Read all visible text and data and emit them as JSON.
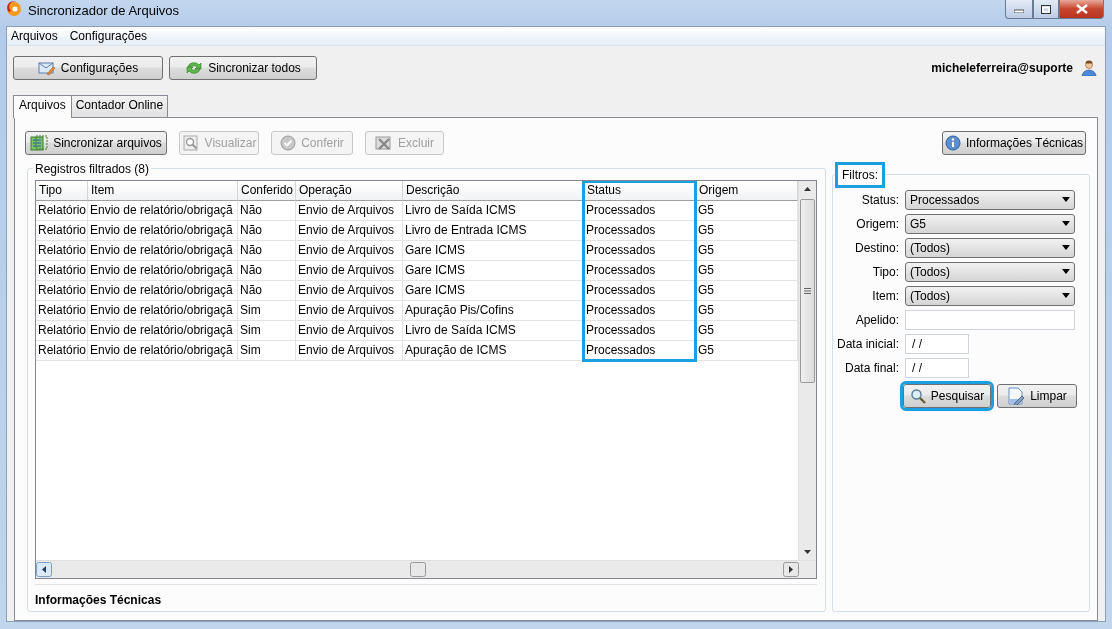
{
  "window": {
    "title": "Sincronizador de Arquivos"
  },
  "menu": [
    {
      "label": "Arquivos"
    },
    {
      "label": "Configurações"
    }
  ],
  "toolbar": [
    {
      "label": "Configurações"
    },
    {
      "label": "Sincronizar todos"
    }
  ],
  "user": "micheleferreira@suporte",
  "tabs": [
    {
      "label": "Arquivos",
      "selected": true
    },
    {
      "label": "Contador Online",
      "selected": false
    }
  ],
  "actions": [
    {
      "label": "Sincronizar arquivos",
      "disabled": false
    },
    {
      "label": "Visualizar",
      "disabled": true
    },
    {
      "label": "Conferir",
      "disabled": true
    },
    {
      "label": "Excluir",
      "disabled": true
    }
  ],
  "info_button": {
    "label": "Informações Técnicas"
  },
  "records": {
    "title": "Registros filtrados (8)",
    "columns": [
      {
        "label": "Tipo",
        "highlighted": false
      },
      {
        "label": "Item",
        "highlighted": false
      },
      {
        "label": "Conferido",
        "highlighted": false
      },
      {
        "label": "Operação",
        "highlighted": false
      },
      {
        "label": "Descrição",
        "highlighted": false
      },
      {
        "label": "Status",
        "highlighted": true
      },
      {
        "label": "Origem",
        "highlighted": false
      }
    ],
    "rows": [
      [
        "Relatório",
        "Envio de relatório/obrigaçã",
        "Não",
        "Envio de Arquivos",
        "Livro de Saída ICMS",
        "Processados",
        "G5"
      ],
      [
        "Relatório",
        "Envio de relatório/obrigaçã",
        "Não",
        "Envio de Arquivos",
        "Livro de Entrada ICMS",
        "Processados",
        "G5"
      ],
      [
        "Relatório",
        "Envio de relatório/obrigaçã",
        "Não",
        "Envio de Arquivos",
        "Gare ICMS",
        "Processados",
        "G5"
      ],
      [
        "Relatório",
        "Envio de relatório/obrigaçã",
        "Não",
        "Envio de Arquivos",
        "Gare ICMS",
        "Processados",
        "G5"
      ],
      [
        "Relatório",
        "Envio de relatório/obrigaçã",
        "Não",
        "Envio de Arquivos",
        "Gare ICMS",
        "Processados",
        "G5"
      ],
      [
        "Relatório",
        "Envio de relatório/obrigaçã",
        "Sim",
        "Envio de Arquivos",
        "Apuração Pis/Cofins",
        "Processados",
        "G5"
      ],
      [
        "Relatório",
        "Envio de relatório/obrigaçã",
        "Sim",
        "Envio de Arquivos",
        "Livro de Saída ICMS",
        "Processados",
        "G5"
      ],
      [
        "Relatório",
        "Envio de relatório/obrigaçã",
        "Sim",
        "Envio de Arquivos",
        "Apuração de ICMS",
        "Processados",
        "G5"
      ]
    ],
    "footer": "Informações Técnicas"
  },
  "filters": {
    "title": "Filtros:",
    "highlighted": true,
    "fields": [
      {
        "kind": "select",
        "label": "Status:",
        "value": "Processados"
      },
      {
        "kind": "select",
        "label": "Origem:",
        "value": "G5"
      },
      {
        "kind": "select",
        "label": "Destino:",
        "value": "(Todos)"
      },
      {
        "kind": "select",
        "label": "Tipo:",
        "value": "(Todos)"
      },
      {
        "kind": "select",
        "label": "Item:",
        "value": "(Todos)"
      },
      {
        "kind": "text",
        "label": "Apelido:"
      },
      {
        "kind": "date",
        "label": "Data inicial:",
        "value": "/ /"
      },
      {
        "kind": "date",
        "label": "Data final:",
        "value": "/ /"
      }
    ],
    "buttons": [
      {
        "label": "Pesquisar",
        "highlighted": true
      },
      {
        "label": "Limpar",
        "highlighted": false
      }
    ]
  }
}
